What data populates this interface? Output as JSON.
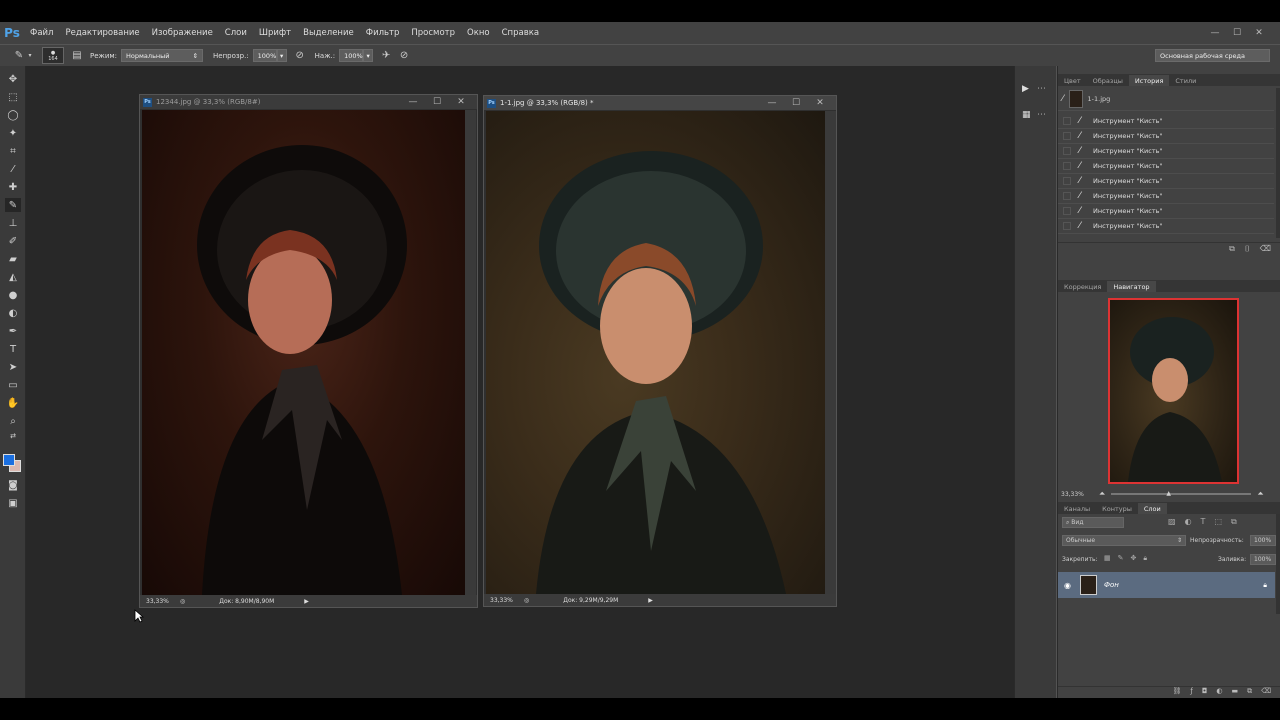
{
  "app": {
    "logo": "Ps",
    "menu": [
      "Файл",
      "Редактирование",
      "Изображение",
      "Слои",
      "Шрифт",
      "Выделение",
      "Фильтр",
      "Просмотр",
      "Окно",
      "Справка"
    ],
    "window_controls": [
      "—",
      "☐",
      "✕"
    ]
  },
  "options": {
    "brush_size": "164",
    "mode_label": "Режим:",
    "mode_value": "Нормальный",
    "opacity_label": "Непрозр.:",
    "opacity_value": "100%",
    "pressure_label": "Наж.:",
    "pressure_value": "100%",
    "workspace": "Основная рабочая среда"
  },
  "documents": [
    {
      "title": "12344.jpg @ 33,3% (RGB/8#)",
      "zoom": "33,33%",
      "doc_size": "Док: 8,90M/8,90M"
    },
    {
      "title": "1-1.jpg @ 33,3% (RGB/8) *",
      "zoom": "33,33%",
      "doc_size": "Док: 9,29M/9,29M"
    }
  ],
  "history_panel": {
    "tabs": [
      "Цвет",
      "Образцы",
      "История",
      "Стили"
    ],
    "active_tab": "История",
    "snapshot": "1-1.jpg",
    "items": [
      "Инструмент \"Кисть\"",
      "Инструмент \"Кисть\"",
      "Инструмент \"Кисть\"",
      "Инструмент \"Кисть\"",
      "Инструмент \"Кисть\"",
      "Инструмент \"Кисть\"",
      "Инструмент \"Кисть\"",
      "Инструмент \"Кисть\""
    ]
  },
  "navigator_panel": {
    "tabs": [
      "Коррекция",
      "Навигатор"
    ],
    "active_tab": "Навигатор",
    "zoom": "33,33%"
  },
  "layers_panel": {
    "tabs": [
      "Каналы",
      "Контуры",
      "Слои"
    ],
    "active_tab": "Слои",
    "kind_filter": "Вид",
    "blend_mode": "Обычные",
    "opacity_label": "Непрозрачность:",
    "opacity_value": "100%",
    "lock_label": "Закрепить:",
    "fill_label": "Заливка:",
    "fill_value": "100%",
    "layer_name": "Фон"
  },
  "colors": {
    "foreground": "#1a6fe0",
    "background": "#d9b8b0",
    "accent_layer": "#5b6b80",
    "nav_box": "#dd3333"
  }
}
